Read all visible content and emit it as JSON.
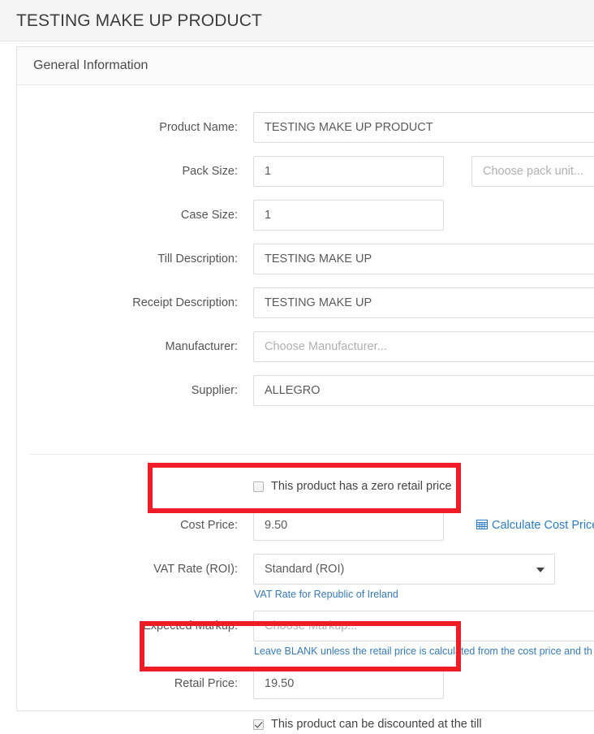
{
  "page": {
    "title": "TESTING MAKE UP PRODUCT"
  },
  "panel": {
    "heading": "General Information"
  },
  "form": {
    "fields": [
      {
        "label": "Product Name:",
        "value": "TESTING MAKE UP PRODUCT",
        "placeholder": ""
      },
      {
        "label": "Pack Size:",
        "value": "1",
        "placeholder": ""
      },
      {
        "label": "Case Size:",
        "value": "1",
        "placeholder": ""
      },
      {
        "label": "Till Description:",
        "value": "TESTING MAKE UP",
        "placeholder": ""
      },
      {
        "label": "Receipt Description:",
        "value": "TESTING MAKE UP",
        "placeholder": ""
      },
      {
        "label": "Manufacturer:",
        "value": "",
        "placeholder": "Choose Manufacturer..."
      },
      {
        "label": "Supplier:",
        "value": "ALLEGRO",
        "placeholder": ""
      }
    ],
    "pack_unit": {
      "placeholder": "Choose pack unit...",
      "value": ""
    },
    "zero_retail_checkbox": {
      "label": "This product has a zero retail price",
      "checked": false
    },
    "cost_price": {
      "label": "Cost Price:",
      "value": "9.50"
    },
    "calculate_cost_price": {
      "label": "Calculate Cost Price",
      "icon": "grid-table-icon",
      "color": "#2b7bc4"
    },
    "vat_rate": {
      "label": "VAT Rate (ROI):",
      "value": "Standard (ROI)",
      "hint": "VAT Rate for Republic of Ireland"
    },
    "expected_markup": {
      "label": "Expected Markup:",
      "value": "",
      "placeholder": "Choose Markup...",
      "hint": "Leave BLANK unless the retail price is calculated from the cost price and th"
    },
    "retail_price": {
      "label": "Retail Price:",
      "value": "19.50"
    },
    "discount_checkbox": {
      "label": "This product can be discounted at the till",
      "checked": true
    }
  },
  "annotations": {
    "highlight_color": "#ee1c25",
    "boxes": [
      "cost-price-row",
      "retail-price-row"
    ]
  }
}
